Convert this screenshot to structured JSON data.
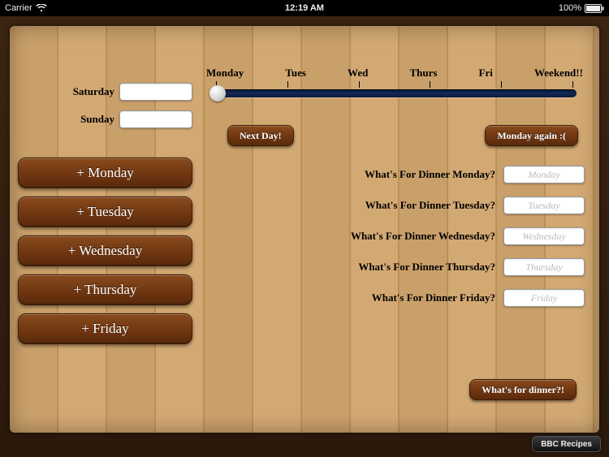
{
  "status_bar": {
    "carrier": "Carrier",
    "time": "12:19 AM",
    "battery_pct": "100%"
  },
  "timeline": {
    "labels": [
      "Monday",
      "Tues",
      "Wed",
      "Thurs",
      "Fri",
      "Weekend!!"
    ]
  },
  "controls": {
    "next_day": "Next Day!",
    "monday_again": "Monday again :(",
    "whats_for_dinner": "What's for dinner?!",
    "bbc_recipes": "BBC Recipes"
  },
  "weekend_inputs": {
    "saturday_label": "Saturday",
    "sunday_label": "Sunday",
    "saturday_value": "",
    "sunday_value": ""
  },
  "day_buttons": [
    "+ Monday",
    "+ Tuesday",
    "+ Wednesday",
    "+ Thursday",
    "+ Friday"
  ],
  "dinner_rows": [
    {
      "label": "What's For Dinner Monday?",
      "placeholder": "Monday"
    },
    {
      "label": "What's For Dinner Tuesday?",
      "placeholder": "Tuesday"
    },
    {
      "label": "What's For Dinner Wednesday?",
      "placeholder": "Wednesday"
    },
    {
      "label": "What's For Dinner Thursday?",
      "placeholder": "Thursday"
    },
    {
      "label": "What's For Dinner Friday?",
      "placeholder": "Friday"
    }
  ],
  "colors": {
    "wood_dark": "#5a2a0c",
    "wood_light": "#caa06a",
    "slider_track": "#122a55"
  }
}
